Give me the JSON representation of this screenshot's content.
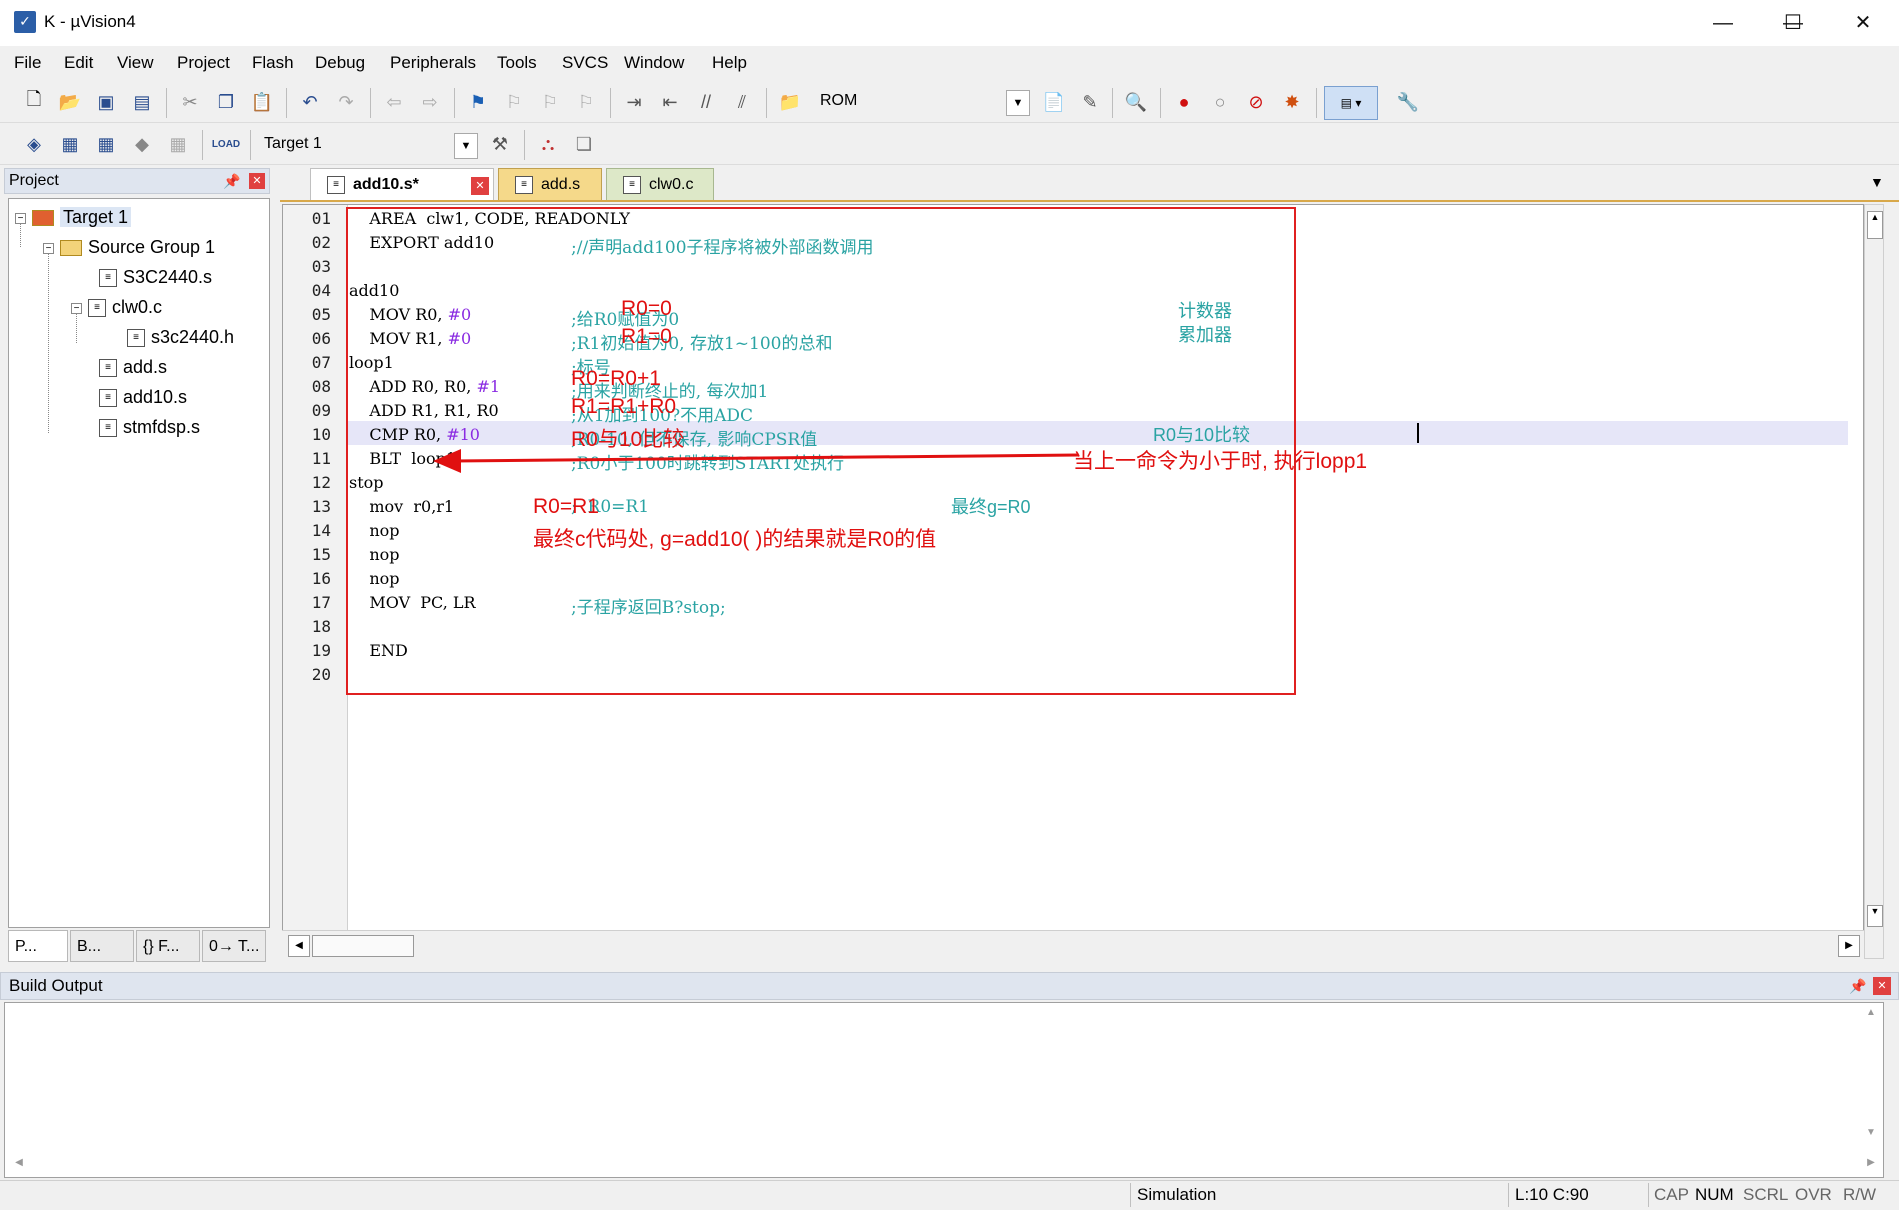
{
  "window": {
    "title": "K  - µVision4",
    "app_icon": "uv4-logo-icon"
  },
  "menu": [
    "File",
    "Edit",
    "View",
    "Project",
    "Flash",
    "Debug",
    "Peripherals",
    "Tools",
    "SVCS",
    "Window",
    "Help"
  ],
  "toolbar1": {
    "target_memory": "ROM"
  },
  "toolbar2": {
    "target_select": "Target 1"
  },
  "project": {
    "header": "Project",
    "tree": [
      {
        "label": "Target 1",
        "level": 0,
        "icon": "target-icon",
        "expander": "⊟"
      },
      {
        "label": "Source Group 1",
        "level": 1,
        "icon": "folder-icon",
        "expander": "⊟"
      },
      {
        "label": "S3C2440.s",
        "level": 2,
        "icon": "file-icon"
      },
      {
        "label": "clw0.c",
        "level": 2,
        "icon": "file-icon",
        "expander": "⊟"
      },
      {
        "label": "s3c2440.h",
        "level": 3,
        "icon": "header-file-icon"
      },
      {
        "label": "add.s",
        "level": 2,
        "icon": "file-icon"
      },
      {
        "label": "add10.s",
        "level": 2,
        "icon": "file-icon"
      },
      {
        "label": "stmfdsp.s",
        "level": 2,
        "icon": "file-icon"
      }
    ],
    "tabs": [
      "P...",
      "B...",
      "{} F...",
      "0→ T..."
    ]
  },
  "editor": {
    "tabs": [
      {
        "label": "add10.s*",
        "active": true
      },
      {
        "label": "add.s",
        "active": false
      },
      {
        "label": "clw0.c",
        "active": false
      }
    ],
    "line_numbers": [
      "01",
      "02",
      "03",
      "04",
      "05",
      "06",
      "07",
      "08",
      "09",
      "10",
      "11",
      "12",
      "13",
      "14",
      "15",
      "16",
      "17",
      "18",
      "19",
      "20"
    ],
    "code": [
      {
        "text": "    AREA  clw1, CODE, READONLY",
        "comment": ""
      },
      {
        "text": "    EXPORT add10    ",
        "comment": ";//声明add100子程序将被外部函数调用"
      },
      {
        "text": "",
        "comment": ""
      },
      {
        "text": "add10",
        "comment": ""
      },
      {
        "text": "    MOV R0, ",
        "num": "#0",
        "comment": ";给R0赋值为0"
      },
      {
        "text": "    MOV R1, ",
        "num": "#0",
        "comment": ";R1初始值为0, 存放1~100的总和"
      },
      {
        "text": "loop1",
        "comment": ";标号"
      },
      {
        "text": "    ADD R0, R0, ",
        "num": "#1",
        "comment": ";用来判断终止的, 每次加1"
      },
      {
        "text": "    ADD R1, R1, R0",
        "comment": ";从1加到100?不用ADC"
      },
      {
        "text": "    CMP R0, ",
        "num": "#10",
        "comment": ";R0-10, 但不保存, 影响CPSR值"
      },
      {
        "text": "    BLT  loop1",
        "comment": ";R0小于100时跳转到START处执行"
      },
      {
        "text": "stop",
        "comment": ""
      },
      {
        "text": "    mov  r0,r1",
        "comment": ";  R0=R1"
      },
      {
        "text": "    nop",
        "comment": ""
      },
      {
        "text": "    nop",
        "comment": ""
      },
      {
        "text": "    nop",
        "comment": ""
      },
      {
        "text": "    MOV  PC, LR",
        "comment": ";子程序返回B?stop;"
      },
      {
        "text": "",
        "comment": ""
      },
      {
        "text": "    END",
        "comment": ""
      },
      {
        "text": "",
        "comment": ""
      }
    ],
    "side_comments": {
      "counter": "计数器",
      "accumulator": "累加器",
      "r0_cmp_10": "R0与10比较",
      "final_g": "最终g=R0"
    },
    "annotations": {
      "r0_zero": "R0=0",
      "r1_zero": "R1=0",
      "r0_inc": "R0=R0+1",
      "r1_add": "R1=R1+R0",
      "cmp": "R0与10比较",
      "arrow_note": "当上一命令为小于时, 执行lopp1",
      "r0_r1": "R0=R1",
      "final": "最终c代码处, g=add10( )的结果就是R0的值"
    },
    "highlight_color": "#e6e6f8",
    "annotation_color": "#e01010"
  },
  "build_output": {
    "header": "Build Output"
  },
  "status": {
    "mode": "Simulation",
    "position": "L:10 C:90",
    "indicators": [
      "CAP",
      "NUM",
      "SCRL",
      "OVR",
      "R/W"
    ]
  }
}
